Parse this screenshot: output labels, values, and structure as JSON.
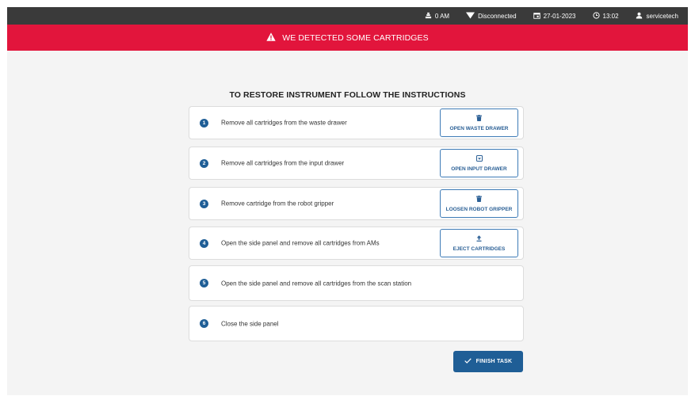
{
  "status_bar": {
    "counter": "0 AM",
    "connection": "Disconnected",
    "date": "27-01-2023",
    "time": "13:02",
    "user": "servicetech"
  },
  "alert": {
    "message": "WE DETECTED SOME CARTRIDGES",
    "color": "#e2153c"
  },
  "title": "TO RESTORE INSTRUMENT FOLLOW THE INSTRUCTIONS",
  "steps": [
    {
      "number": "1",
      "text": "Remove all cartridges from the waste drawer",
      "action_label": "OPEN WASTE DRAWER",
      "action_icon": "trash-icon"
    },
    {
      "number": "2",
      "text": "Remove all cartridges from the input drawer",
      "action_label": "OPEN INPUT DRAWER",
      "action_icon": "tray-icon"
    },
    {
      "number": "3",
      "text": "Remove cartridge from the robot gripper",
      "action_label": "LOOSEN ROBOT GRIPPER",
      "action_icon": "trash-icon"
    },
    {
      "number": "4",
      "text": "Open the side panel and remove all cartridges from AMs",
      "action_label": "EJECT CARTRIDGES",
      "action_icon": "upload-icon"
    },
    {
      "number": "5",
      "text": "Open the side panel and remove all cartridges from the scan station"
    },
    {
      "number": "6",
      "text": "Close the side panel"
    }
  ],
  "finish_label": "FINISH TASK",
  "accent_color": "#1f5e96"
}
